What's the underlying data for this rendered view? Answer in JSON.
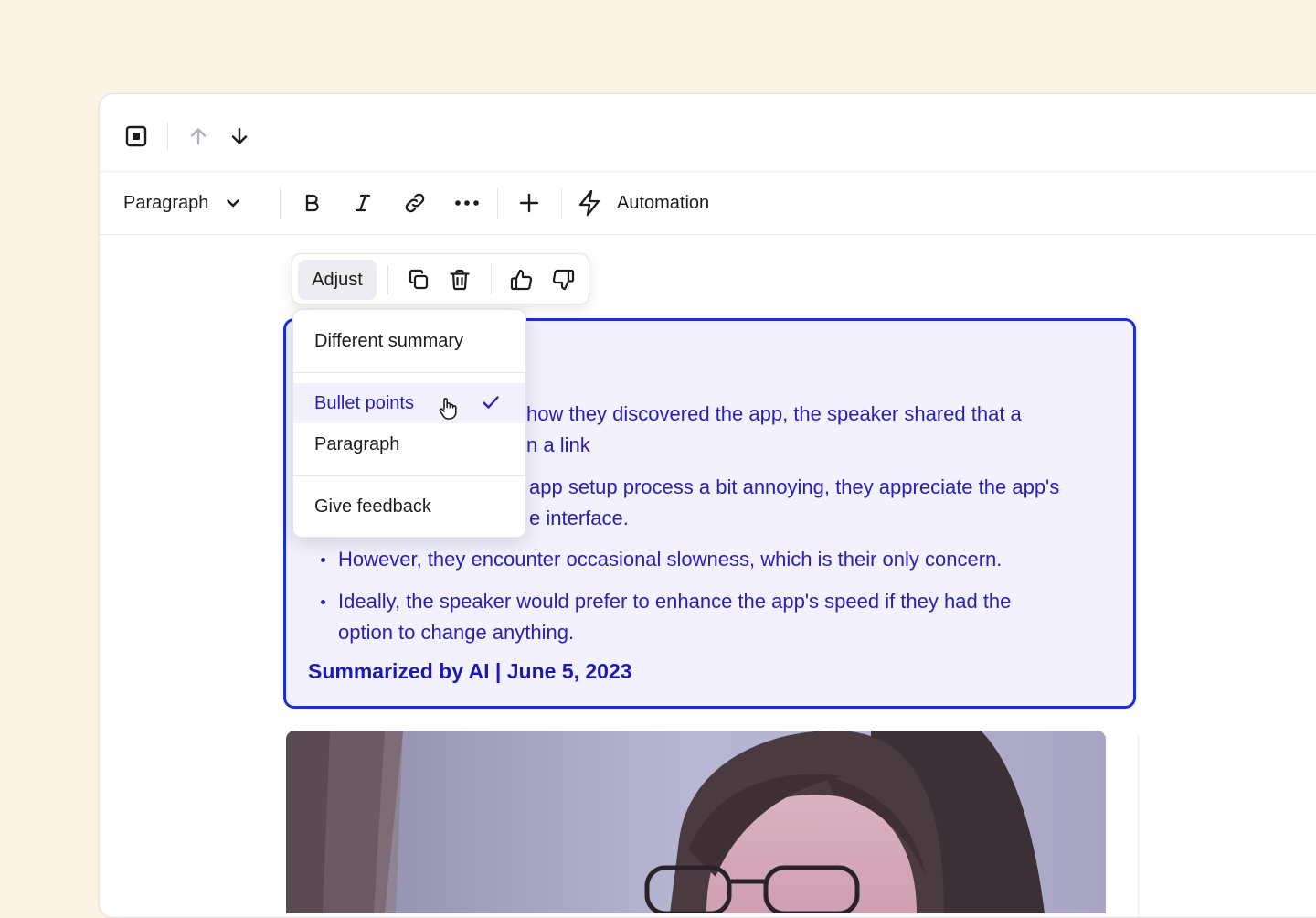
{
  "toolbar": {
    "block_style": "Paragraph",
    "automation_label": "Automation"
  },
  "action_bar": {
    "adjust_label": "Adjust"
  },
  "adjust_menu": {
    "items": [
      {
        "label": "Different summary"
      },
      {
        "label": "Bullet points",
        "selected": true
      },
      {
        "label": "Paragraph"
      },
      {
        "label": "Give feedback"
      }
    ]
  },
  "summary": {
    "visible_lines": [
      "how they discovered the app, the speaker shared that a",
      "n a link",
      "app setup process a bit annoying, they appreciate the app's",
      "e interface.",
      "However, they encounter occasional slowness, which is their only concern.",
      "Ideally, the speaker would prefer to enhance the app's speed if they had the",
      "option to change anything."
    ],
    "footer": "Summarized by AI | June 5, 2023"
  },
  "colors": {
    "page_background": "#fcf3e4",
    "accent": "#1b2fd6",
    "summary_text": "#2b20b0",
    "summary_background": "#f3f1fd"
  }
}
